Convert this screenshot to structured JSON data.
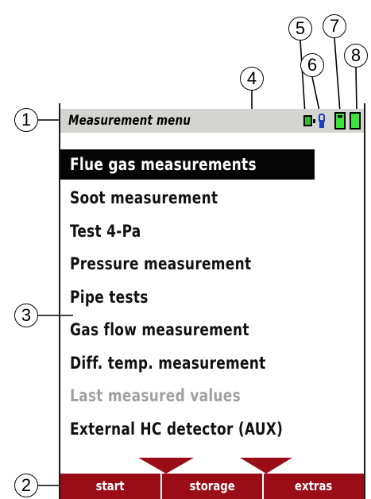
{
  "callouts": [
    "1",
    "2",
    "3",
    "4",
    "5",
    "6",
    "7",
    "8"
  ],
  "statusbar": {
    "title": "Measurement menu",
    "icons": [
      "power-icon",
      "probe-icon",
      "battery-icon",
      "battery-full-icon"
    ]
  },
  "menu": {
    "items": [
      {
        "label": "Flue gas measurements",
        "state": "selected"
      },
      {
        "label": "Soot measurement",
        "state": "normal"
      },
      {
        "label": "Test 4-Pa",
        "state": "normal"
      },
      {
        "label": "Pressure measurement",
        "state": "normal"
      },
      {
        "label": "Pipe tests",
        "state": "normal"
      },
      {
        "label": "Gas flow measurement",
        "state": "normal"
      },
      {
        "label": "Diff. temp. measurement",
        "state": "normal"
      },
      {
        "label": "Last measured values",
        "state": "disabled"
      },
      {
        "label": "External HC detector (AUX)",
        "state": "normal"
      }
    ]
  },
  "softkeys": [
    "start",
    "storage",
    "extras"
  ],
  "colors": {
    "statusbar_bg": "#d4d4d0",
    "selected_bg": "#050505",
    "softkey_bg": "#9a0d17",
    "battery_green": "#3be33b",
    "probe_blue": "#1a3fb8",
    "disabled_text": "#a0a0a0"
  }
}
